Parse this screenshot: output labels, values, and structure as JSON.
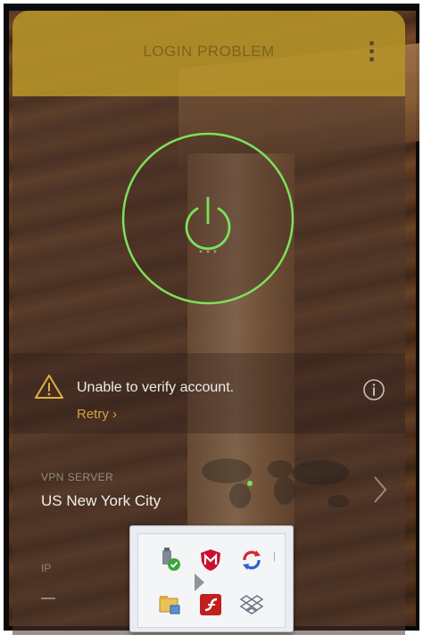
{
  "header": {
    "title": "LOGIN PROBLEM",
    "menu_icon": "more-vertical-icon"
  },
  "power": {
    "icon": "power-icon",
    "ring_color": "#7ee05a"
  },
  "status": {
    "warning_icon": "warning-triangle-icon",
    "message": "Unable to verify account.",
    "retry_label": "Retry ›",
    "info_icon": "info-circle-icon",
    "retry_color": "#d4a33d"
  },
  "server": {
    "label": "VPN SERVER",
    "value": "US New York City",
    "chevron_icon": "chevron-right-icon"
  },
  "ip": {
    "label": "IP",
    "value": "—"
  },
  "tray": {
    "icons": [
      "usb-safely-remove-icon",
      "mcafee-shield-icon",
      "sync-red-icon",
      "network-folder-icon",
      "flash-red-icon",
      "dropbox-icon"
    ],
    "expand_icon": "tray-arrow-icon"
  },
  "colors": {
    "header_bg": "#c4a028",
    "accent_green": "#7ee05a",
    "retry_orange": "#d4a33d"
  }
}
